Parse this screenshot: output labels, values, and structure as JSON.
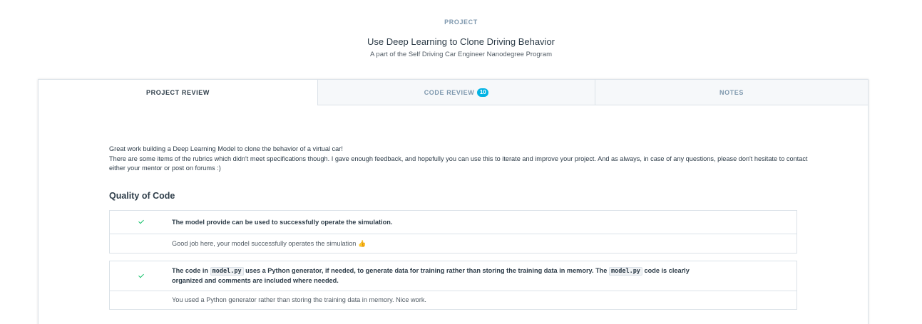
{
  "header": {
    "eyebrow": "PROJECT",
    "title": "Use Deep Learning to Clone Driving Behavior",
    "subtitle": "A part of the Self Driving Car Engineer Nanodegree Program"
  },
  "tabs": [
    {
      "label": "PROJECT REVIEW",
      "active": true
    },
    {
      "label": "CODE REVIEW",
      "badge": "10",
      "active": false
    },
    {
      "label": "NOTES",
      "active": false
    }
  ],
  "intro": {
    "line1": "Great work building a Deep Learning Model to clone the behavior of a virtual car!",
    "line2": "There are some items of the rubrics which didn't meet specifications though. I gave enough feedback, and hopefully you can use this to iterate and improve your project. And as always, in case of any questions, please don't hesitate to contact either your mentor or post on forums :)"
  },
  "section": {
    "title": "Quality of Code"
  },
  "specs": [
    {
      "status": "check-icon",
      "criterion": "The model provide can be used to successfully operate the simulation.",
      "feedback": "Good job here, your model successfully operates the simulation",
      "feedback_emoji": "👍"
    },
    {
      "status": "check-icon",
      "criterion_part1": "The code in",
      "criterion_code1": "model.py",
      "criterion_part2": "uses a Python generator, if needed, to generate data for training rather than storing the training data in memory. The",
      "criterion_code2": "model.py",
      "criterion_part3": "code is clearly",
      "criterion_line2": "organized and comments are included where needed.",
      "feedback": "You used a Python generator rather than storing the training data in memory. Nice work."
    }
  ],
  "colors": {
    "accent": "#02b3e4",
    "check": "#15c26b",
    "text": "#2e3d49",
    "muted": "#7d97ad",
    "border": "#dbe2e8"
  }
}
